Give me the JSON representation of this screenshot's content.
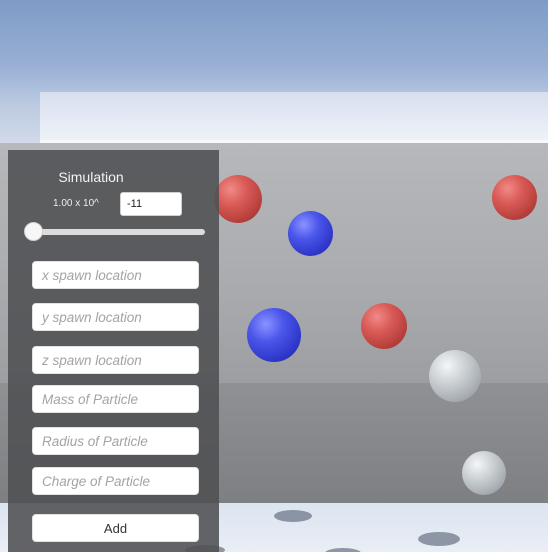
{
  "simulation": {
    "title": "Simulation",
    "exponent_label": "1.00 x 10^",
    "exponent_value": "-11",
    "slider_value": 0
  },
  "fields": {
    "x_placeholder": "x spawn location",
    "y_placeholder": "y spawn location",
    "z_placeholder": "z spawn location",
    "mass_placeholder": "Mass of Particle",
    "radius_placeholder": "Radius of Particle",
    "charge_placeholder": "Charge of Particle"
  },
  "buttons": {
    "add_label": "Add"
  },
  "colors": {
    "red_particle": "#d95a56",
    "blue_particle": "#4a55ea",
    "grey_particle": "#cdd2d6",
    "panel_bg": "#4e5052"
  }
}
